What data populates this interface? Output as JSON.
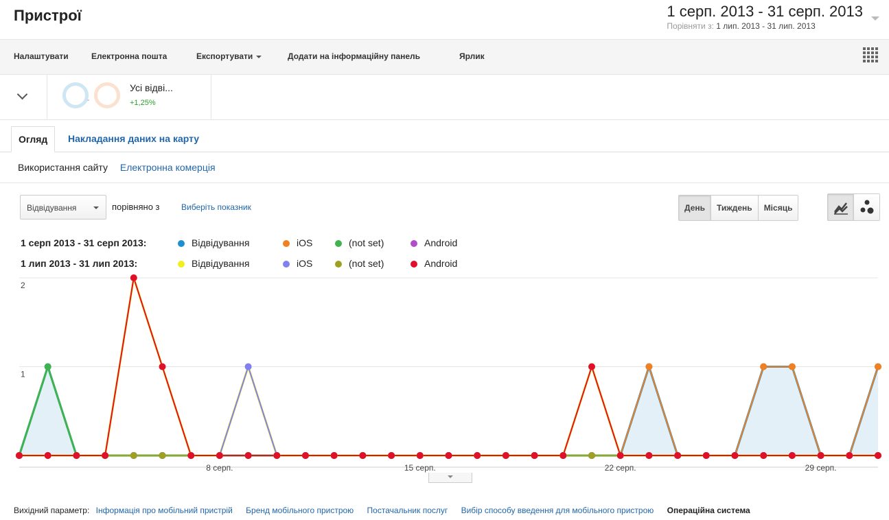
{
  "page_title": "Пристрої",
  "date_range": {
    "main": "1 серп. 2013 - 31 серп. 2013",
    "compare_label": "Порівняти з:",
    "compare_value": "1 лип. 2013 - 31 лип. 2013"
  },
  "toolbar": {
    "customize": "Налаштувати",
    "email": "Електронна пошта",
    "export": "Експортувати",
    "add_dashboard": "Додати на інформаційну панель",
    "shortcut": "Ярлик"
  },
  "segment": {
    "name": "Усі відві...",
    "change": "+1,25%",
    "dash": "-"
  },
  "tabs": {
    "overview": "Огляд",
    "map_overlay": "Накладання даних на карту"
  },
  "subtabs": {
    "site_usage": "Використання сайту",
    "ecommerce": "Електронна комерція"
  },
  "controls": {
    "metric": "Відвідування",
    "compare_with": "порівняно з",
    "pick_metric": "Виберіть показник",
    "day": "День",
    "week": "Тиждень",
    "month": "Місяць"
  },
  "legend": {
    "row1_label": "1 серп 2013 - 31 серп 2013:",
    "row1": [
      {
        "name": "Відвідування",
        "color": "#1f8fcf"
      },
      {
        "name": "iOS",
        "color": "#f08020"
      },
      {
        "name": "(not set)",
        "color": "#3fb34f"
      },
      {
        "name": "Android",
        "color": "#b04fc8"
      }
    ],
    "row2_label": "1 лип 2013 - 31 лип 2013:",
    "row2": [
      {
        "name": "Відвідування",
        "color": "#f0f020"
      },
      {
        "name": "iOS",
        "color": "#8080f0"
      },
      {
        "name": "(not set)",
        "color": "#a0a020"
      },
      {
        "name": "Android",
        "color": "#e0102a"
      }
    ]
  },
  "chart_data": {
    "type": "line",
    "x": [
      1,
      2,
      3,
      4,
      5,
      6,
      7,
      8,
      9,
      10,
      11,
      12,
      13,
      14,
      15,
      16,
      17,
      18,
      19,
      20,
      21,
      22,
      23,
      24,
      25,
      26,
      27,
      28,
      29,
      30,
      31
    ],
    "x_tick_labels": [
      {
        "day": 8,
        "label": "8 серп."
      },
      {
        "day": 15,
        "label": "15 серп."
      },
      {
        "day": 22,
        "label": "22 серп."
      },
      {
        "day": 29,
        "label": "29 серп."
      }
    ],
    "y_ticks": [
      1,
      2
    ],
    "ylim": [
      0,
      2
    ],
    "series": [
      {
        "name": "Відвідування",
        "values": [
          0,
          1,
          0,
          0,
          0,
          0,
          0,
          0,
          0,
          0,
          0,
          0,
          0,
          0,
          0,
          0,
          0,
          0,
          0,
          0,
          0,
          0,
          1,
          0,
          0,
          0,
          1,
          1,
          0,
          0,
          1
        ]
      },
      {
        "name": "iOS",
        "values": [
          0,
          0,
          0,
          0,
          0,
          0,
          0,
          0,
          0,
          0,
          0,
          0,
          0,
          0,
          0,
          0,
          0,
          0,
          0,
          0,
          0,
          0,
          1,
          0,
          0,
          0,
          1,
          1,
          0,
          0,
          1
        ]
      },
      {
        "name": "(not set)",
        "values": [
          0,
          1,
          0,
          0,
          0,
          0,
          0,
          0,
          0,
          0,
          0,
          0,
          0,
          0,
          0,
          0,
          0,
          0,
          0,
          0,
          0,
          0,
          0,
          0,
          0,
          0,
          0,
          0,
          0,
          0,
          0
        ]
      },
      {
        "name": "Android",
        "values": [
          0,
          0,
          0,
          0,
          0,
          0,
          0,
          0,
          0,
          0,
          0,
          0,
          0,
          0,
          0,
          0,
          0,
          0,
          0,
          0,
          0,
          0,
          0,
          0,
          0,
          0,
          0,
          0,
          0,
          0,
          0
        ]
      },
      {
        "name": "Відвідування",
        "values": [
          0,
          0,
          0,
          0,
          2,
          1,
          0,
          0,
          1,
          0,
          0,
          0,
          0,
          0,
          0,
          0,
          0,
          0,
          0,
          0,
          1,
          0,
          0,
          0,
          0,
          0,
          0,
          0,
          0,
          0,
          0
        ]
      },
      {
        "name": "iOS",
        "values": [
          0,
          0,
          0,
          0,
          0,
          0,
          0,
          0,
          1,
          0,
          0,
          0,
          0,
          0,
          0,
          0,
          0,
          0,
          0,
          0,
          0,
          0,
          0,
          0,
          0,
          0,
          0,
          0,
          0,
          0,
          0
        ]
      },
      {
        "name": "(not set)",
        "values": [
          0,
          0,
          0,
          0,
          0,
          0,
          0,
          0,
          0,
          0,
          0,
          0,
          0,
          0,
          0,
          0,
          0,
          0,
          0,
          0,
          0,
          0,
          0,
          0,
          0,
          0,
          0,
          0,
          0,
          0,
          0
        ]
      },
      {
        "name": "Android",
        "values": [
          0,
          0,
          0,
          0,
          2,
          1,
          0,
          0,
          0,
          0,
          0,
          0,
          0,
          0,
          0,
          0,
          0,
          0,
          0,
          0,
          1,
          0,
          0,
          0,
          0,
          0,
          0,
          0,
          0,
          0,
          0
        ]
      }
    ]
  },
  "footer": {
    "label": "Вихідний параметр:",
    "links": [
      "Інформація про мобільний пристрій",
      "Бренд мобільного пристрою",
      "Постачальник послуг",
      "Вибір способу введення для мобільного пристрою"
    ],
    "current": "Операційна система"
  }
}
